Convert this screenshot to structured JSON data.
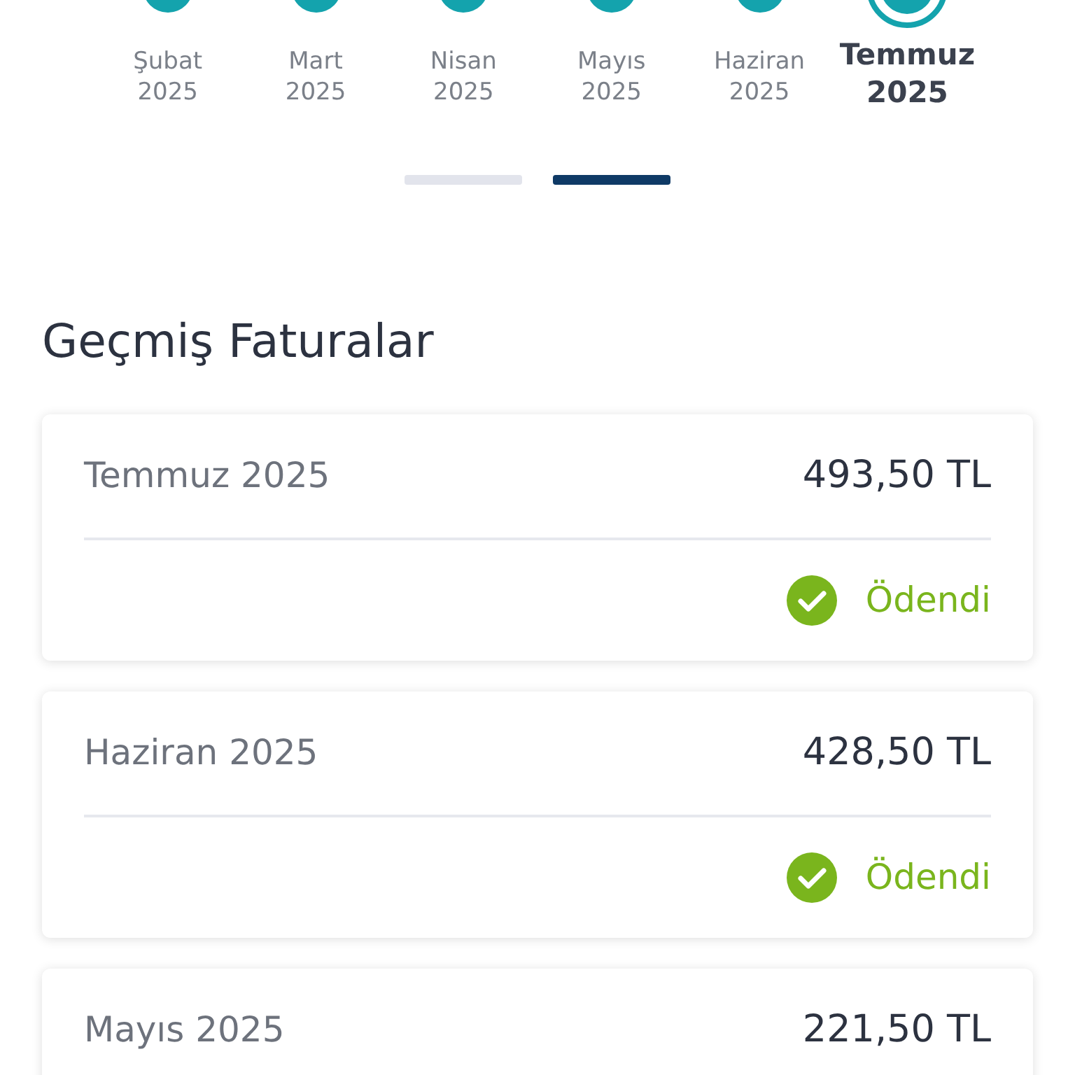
{
  "months": [
    {
      "month": "Şubat",
      "year": "2025",
      "selected": false
    },
    {
      "month": "Mart",
      "year": "2025",
      "selected": false
    },
    {
      "month": "Nisan",
      "year": "2025",
      "selected": false
    },
    {
      "month": "Mayıs",
      "year": "2025",
      "selected": false
    },
    {
      "month": "Haziran",
      "year": "2025",
      "selected": false
    },
    {
      "month": "Temmuz",
      "year": "2025",
      "selected": true
    }
  ],
  "pager": [
    {
      "selected": false
    },
    {
      "selected": true
    }
  ],
  "section_title": "Geçmiş Faturalar",
  "invoices": [
    {
      "period": "Temmuz 2025",
      "amount": "493,50 TL",
      "status": {
        "kind": "paid",
        "label": "Ödendi"
      }
    },
    {
      "period": "Haziran 2025",
      "amount": "428,50 TL",
      "status": {
        "kind": "paid",
        "label": "Ödendi"
      }
    },
    {
      "period": "Mayıs 2025",
      "amount": "221,50 TL"
    }
  ]
}
